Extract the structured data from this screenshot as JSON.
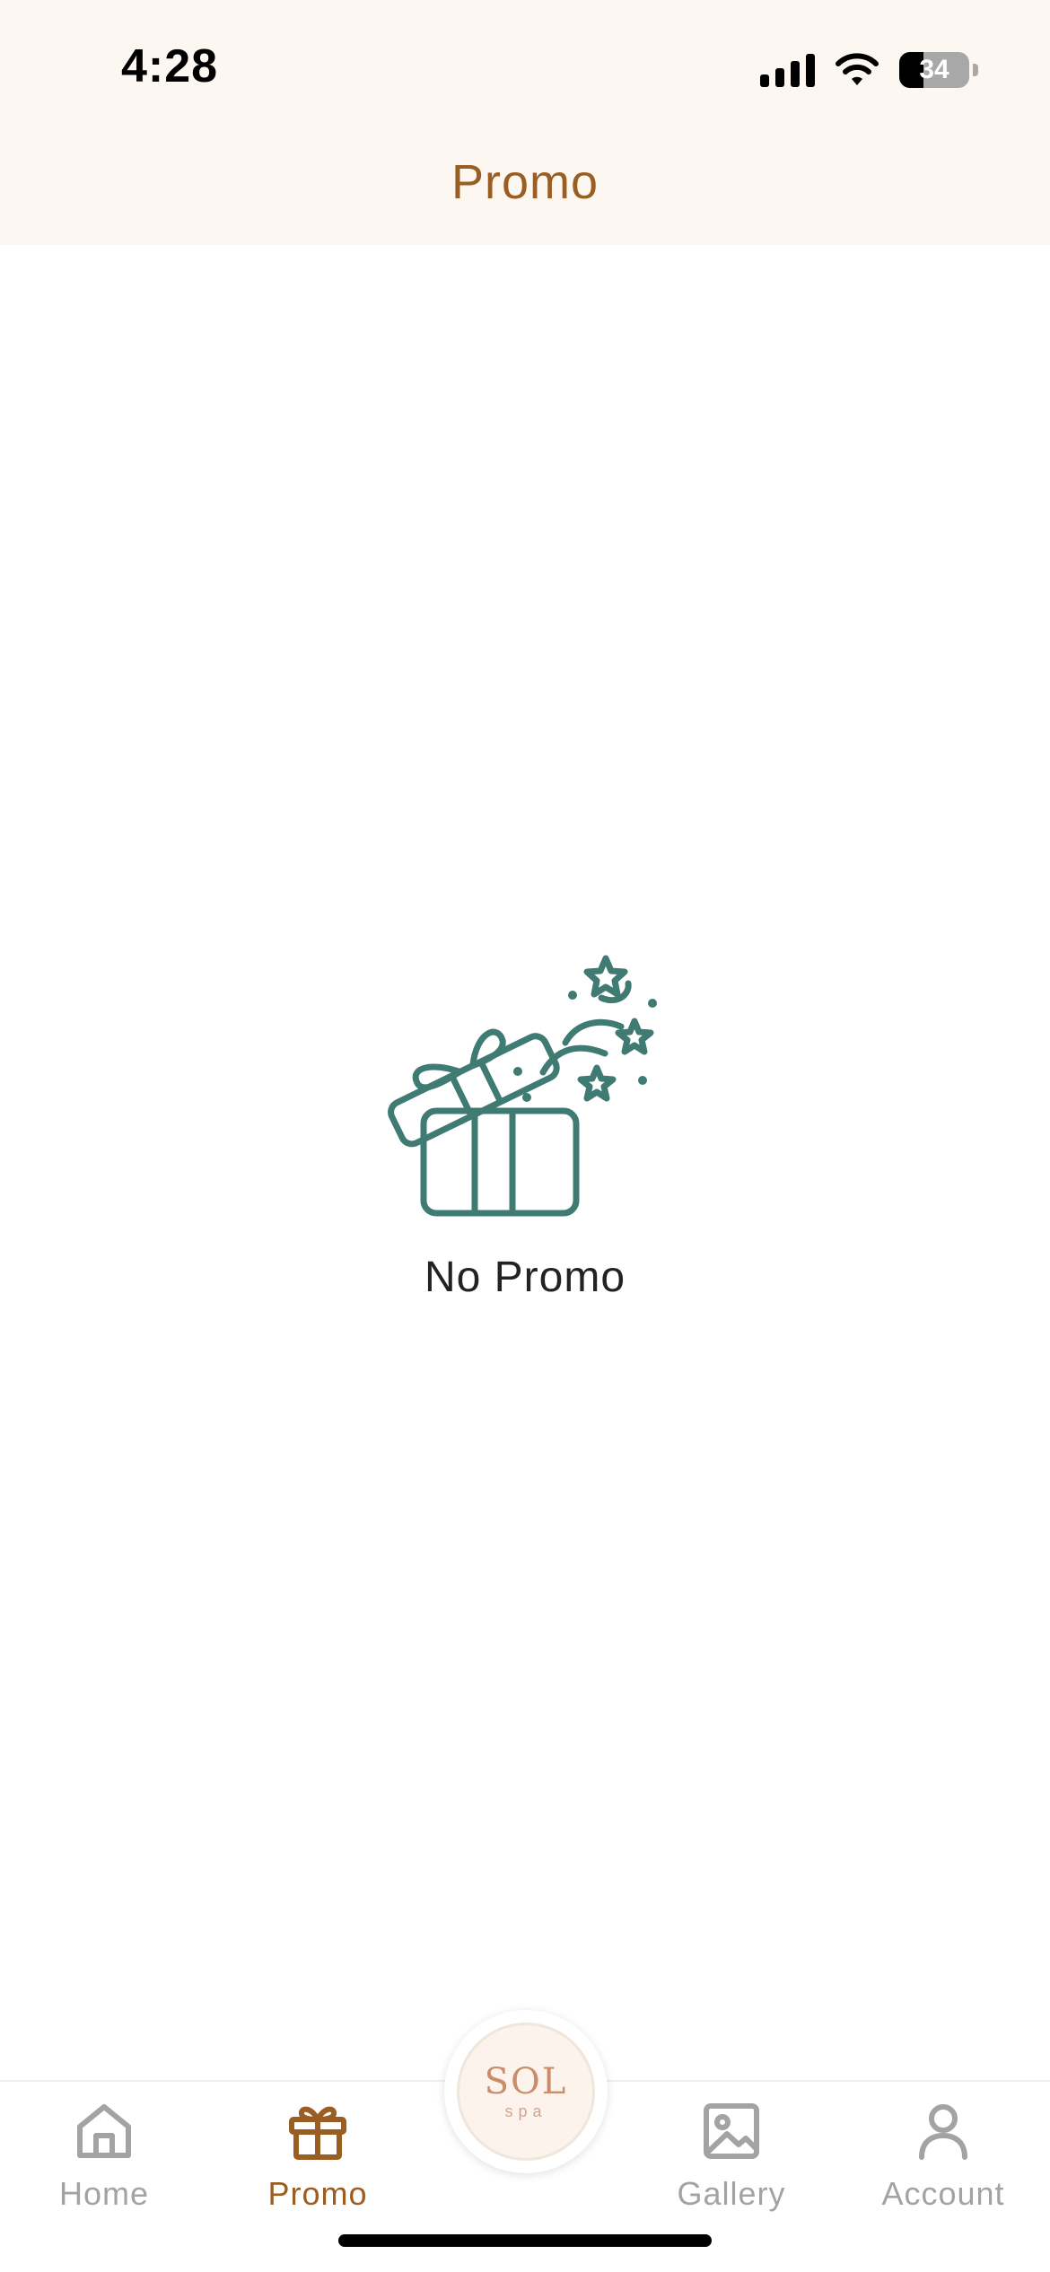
{
  "status_bar": {
    "time": "4:28",
    "battery_percent": "34",
    "battery_level": 0.34,
    "icons": [
      "cellular-signal-icon",
      "wifi-icon",
      "battery-icon"
    ]
  },
  "header": {
    "title": "Promo"
  },
  "empty_state": {
    "icon": "open-gift-box-icon",
    "message": "No Promo"
  },
  "tab_bar": {
    "tabs": [
      {
        "label": "Home",
        "icon": "home-icon",
        "active": false
      },
      {
        "label": "Promo",
        "icon": "gift-icon",
        "active": true
      },
      {
        "label": "Gallery",
        "icon": "image-icon",
        "active": false
      },
      {
        "label": "Account",
        "icon": "user-icon",
        "active": false
      }
    ],
    "center_logo": {
      "text": "SOL",
      "subtext": "spa"
    }
  },
  "colors": {
    "accent": "#9b5e22",
    "header_bg": "#fcf7f1",
    "illustration": "#3f7b72",
    "inactive": "#a3a3a3"
  }
}
